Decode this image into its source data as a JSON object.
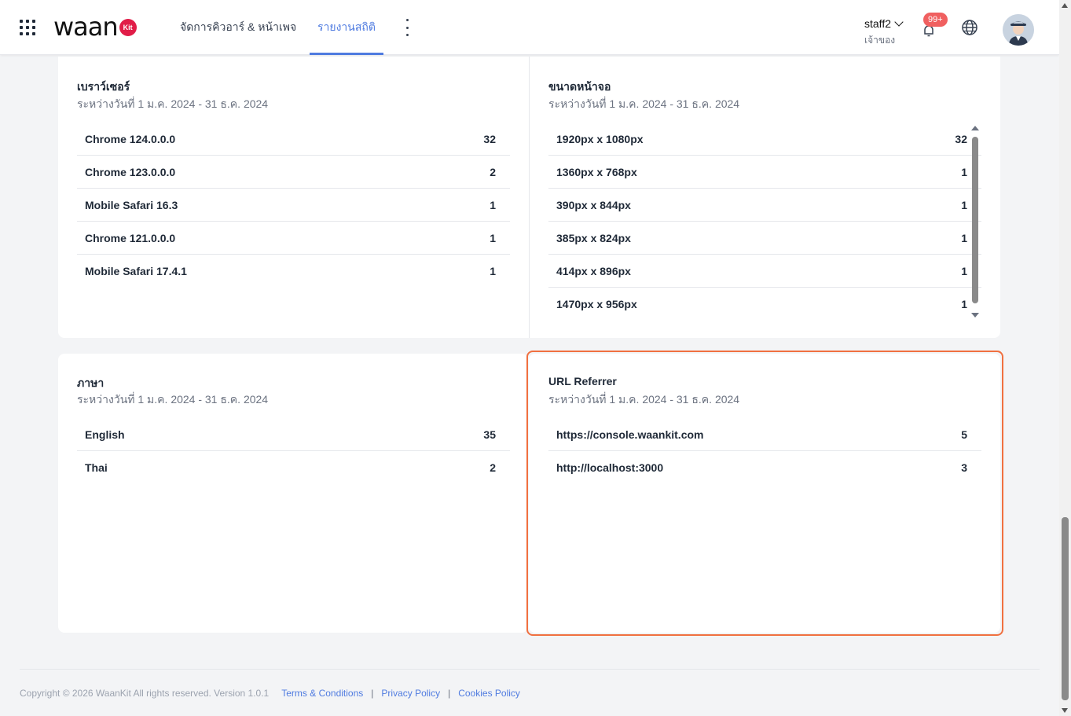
{
  "header": {
    "logo_text": "waan",
    "logo_badge": "Kit",
    "tabs": [
      {
        "label": "จัดการคิวอาร์ & หน้าเพจ",
        "active": false
      },
      {
        "label": "รายงานสถิติ",
        "active": true
      }
    ],
    "user": {
      "name": "staff2",
      "role": "เจ้าของ"
    },
    "notification_badge": "99+",
    "accent_color": "#4f7be0"
  },
  "cards": {
    "browser": {
      "title": "เบราว์เซอร์",
      "subtitle": "ระหว่างวันที่ 1 ม.ค. 2024 - 31 ธ.ค. 2024",
      "rows": [
        {
          "label": "Chrome 124.0.0.0",
          "count": "32"
        },
        {
          "label": "Chrome 123.0.0.0",
          "count": "2"
        },
        {
          "label": "Mobile Safari 16.3",
          "count": "1"
        },
        {
          "label": "Chrome 121.0.0.0",
          "count": "1"
        },
        {
          "label": "Mobile Safari 17.4.1",
          "count": "1"
        }
      ]
    },
    "screen": {
      "title": "ขนาดหน้าจอ",
      "subtitle": "ระหว่างวันที่ 1 ม.ค. 2024 - 31 ธ.ค. 2024",
      "rows": [
        {
          "label": "1920px x 1080px",
          "count": "32"
        },
        {
          "label": "1360px x 768px",
          "count": "1"
        },
        {
          "label": "390px x 844px",
          "count": "1"
        },
        {
          "label": "385px x 824px",
          "count": "1"
        },
        {
          "label": "414px x 896px",
          "count": "1"
        },
        {
          "label": "1470px x 956px",
          "count": "1"
        }
      ]
    },
    "language": {
      "title": "ภาษา",
      "subtitle": "ระหว่างวันที่ 1 ม.ค. 2024 - 31 ธ.ค. 2024",
      "rows": [
        {
          "label": "English",
          "count": "35"
        },
        {
          "label": "Thai",
          "count": "2"
        }
      ]
    },
    "referrer": {
      "title": "URL Referrer",
      "subtitle": "ระหว่างวันที่ 1 ม.ค. 2024 - 31 ธ.ค. 2024",
      "rows": [
        {
          "label": "https://console.waankit.com",
          "count": "5"
        },
        {
          "label": "http://localhost:3000",
          "count": "3"
        }
      ]
    }
  },
  "footer": {
    "copyright": "Copyright © 2026 WaanKit All rights reserved. Version 1.0.1",
    "links": [
      "Terms & Conditions",
      "Privacy Policy",
      "Cookies Policy"
    ],
    "separator": "|"
  },
  "highlight_color": "#f07040"
}
